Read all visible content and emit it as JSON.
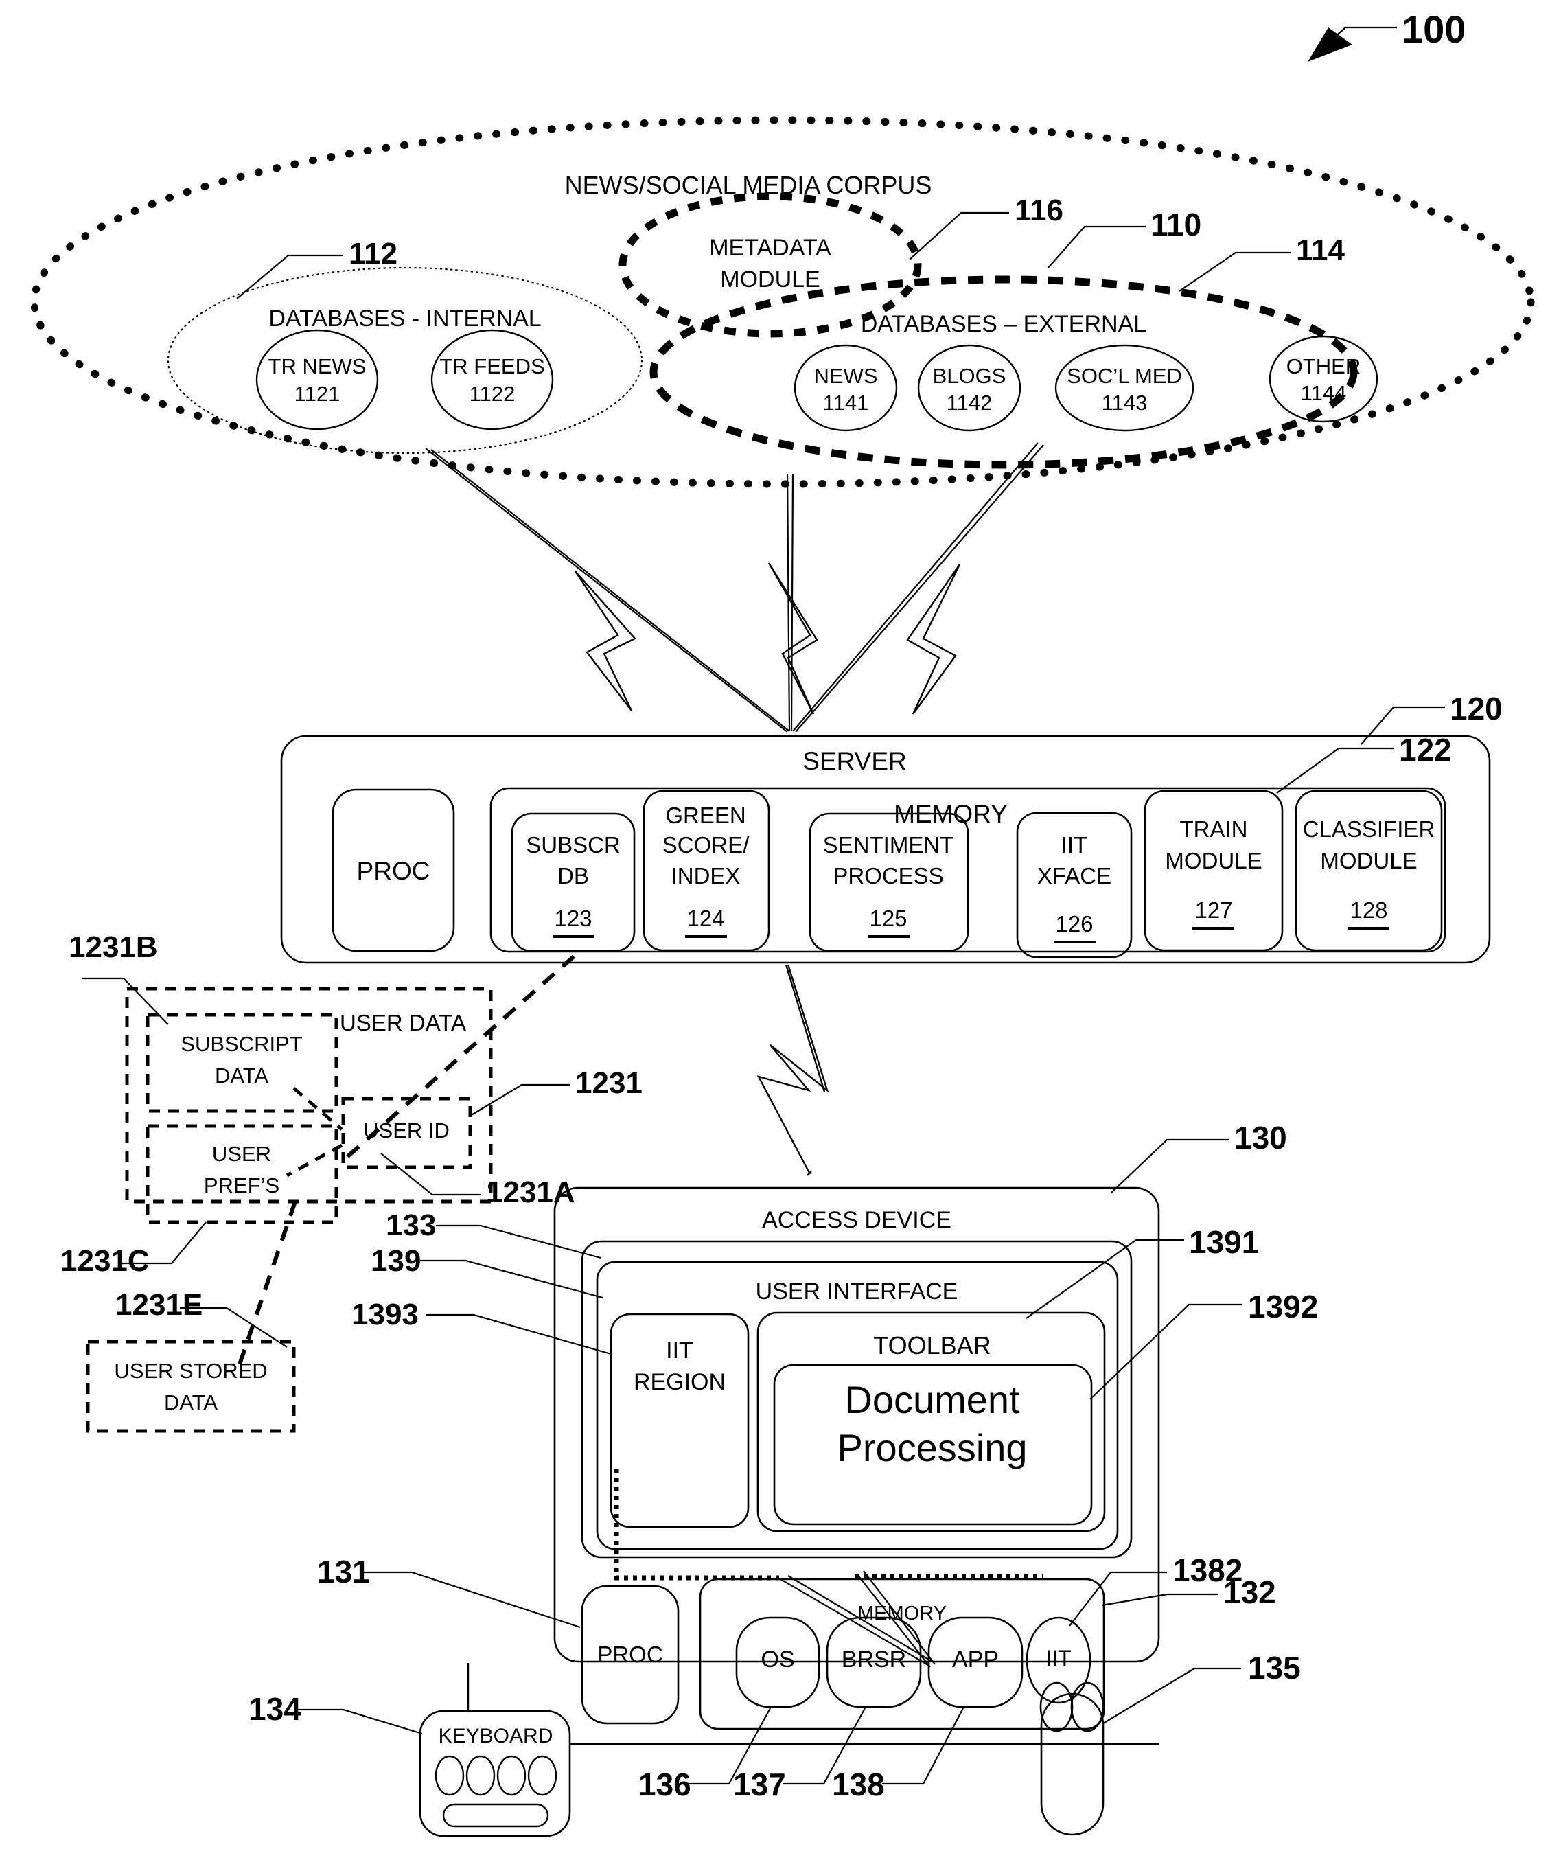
{
  "figure": {
    "number": "100",
    "type": "patent-system-diagram"
  },
  "corpus": {
    "ref": "110",
    "title": "NEWS/SOCIAL MEDIA CORPUS",
    "metadata_module": {
      "ref": "116",
      "line1": "METADATA",
      "line2": "MODULE"
    },
    "internal": {
      "ref": "112",
      "title": "DATABASES - INTERNAL",
      "nodes": [
        {
          "name": "TR NEWS",
          "ref": "1121"
        },
        {
          "name": "TR FEEDS",
          "ref": "1122"
        }
      ]
    },
    "external": {
      "ref": "114",
      "title": "DATABASES – EXTERNAL",
      "nodes": [
        {
          "name": "NEWS",
          "ref": "1141"
        },
        {
          "name": "BLOGS",
          "ref": "1142"
        },
        {
          "name": "SOC’L MED",
          "ref": "1143"
        },
        {
          "name": "OTHER",
          "ref": "1144"
        }
      ]
    }
  },
  "server": {
    "ref": "120",
    "title": "SERVER",
    "proc_label": "PROC",
    "memory": {
      "ref": "122",
      "title": "MEMORY",
      "modules": [
        {
          "line1": "SUBSCR",
          "line2": "DB",
          "ref": "123"
        },
        {
          "line1": "GREEN",
          "line2": "SCORE/",
          "line3": "INDEX",
          "ref": "124"
        },
        {
          "line1": "SENTIMENT",
          "line2": "PROCESS",
          "ref": "125"
        },
        {
          "line1": "IIT",
          "line2": "XFACE",
          "ref": "126"
        },
        {
          "line1": "TRAIN",
          "line2": "MODULE",
          "ref": "127"
        },
        {
          "line1": "CLASSIFIER",
          "line2": "MODULE",
          "ref": "128"
        }
      ]
    }
  },
  "user_data": {
    "ref": "1231",
    "title": "USER DATA",
    "subscript_data": {
      "ref": "1231B",
      "line1": "SUBSCRIPT",
      "line2": "DATA"
    },
    "user_prefs": {
      "ref": "1231C",
      "line1": "USER",
      "line2": "PREF’S"
    },
    "user_id": {
      "ref": "1231A",
      "label": "USER ID"
    },
    "user_stored_data": {
      "ref": "1231E",
      "line1": "USER STORED",
      "line2": "DATA"
    }
  },
  "access_device": {
    "ref": "130",
    "title": "ACCESS DEVICE",
    "display_ref": "133",
    "user_interface": {
      "ref": "139",
      "title": "USER INTERFACE",
      "iit_region": {
        "ref": "1393",
        "line1": "IIT",
        "line2": "REGION"
      },
      "toolbar": {
        "ref": "1391",
        "title": "TOOLBAR"
      },
      "document_processing": {
        "ref": "1392",
        "line1": "Document",
        "line2": "Processing"
      }
    },
    "proc": {
      "ref": "131",
      "label": "PROC"
    },
    "memory": {
      "ref": "132",
      "title": "MEMORY",
      "modules": [
        {
          "label": "OS",
          "ref": "136"
        },
        {
          "label": "BRSR",
          "ref": "137"
        },
        {
          "label": "APP",
          "ref": "138"
        },
        {
          "label": "IIT",
          "ref": "1382"
        }
      ]
    },
    "keyboard": {
      "ref": "134",
      "label": "KEYBOARD"
    },
    "mouse": {
      "ref": "135"
    }
  }
}
